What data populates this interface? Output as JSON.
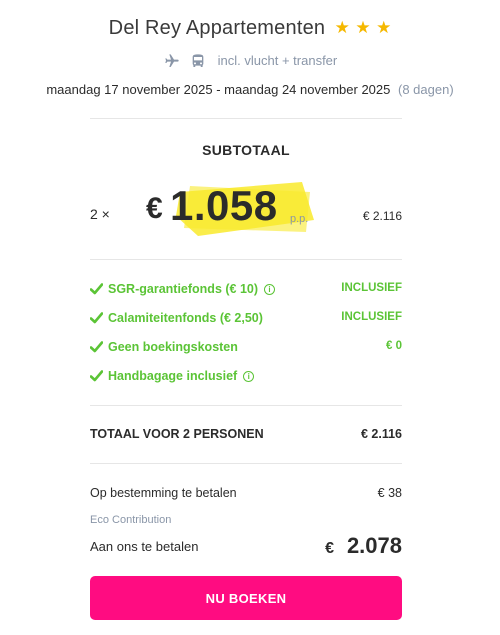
{
  "accommodation": {
    "name": "Del Rey Appartementen",
    "stars": 3,
    "star_glyph": "★",
    "includes_icons": [
      "plane-icon",
      "bus-icon"
    ],
    "includes_text": "incl. vlucht + transfer",
    "dates": "maandag 17 november 2025 - maandag 24 november 2025",
    "duration": "(8 dagen)"
  },
  "pricing": {
    "subtotal_label": "SUBTOTAAL",
    "quantity": "2 ×",
    "currency": "€",
    "price_per_person": "1.058",
    "per_person_label": "p.p.",
    "subtotal_total": "€ 2.116",
    "highlight_color": "#f9ea2c"
  },
  "features": [
    {
      "label": "SGR-garantiefonds (€ 10)",
      "has_info": true,
      "info_glyph": "i",
      "value": "INCLUSIEF"
    },
    {
      "label": "Calamiteitenfonds (€ 2,50)",
      "has_info": false,
      "value": "INCLUSIEF"
    },
    {
      "label": "Geen boekingskosten",
      "has_info": false,
      "value": "€ 0"
    },
    {
      "label": "Handbagage inclusief",
      "has_info": true,
      "info_glyph": "i",
      "value": ""
    }
  ],
  "totals": {
    "total_label": "TOTAAL VOOR 2 PERSONEN",
    "total_value": "€ 2.116",
    "destination_label": "Op bestemming te betalen",
    "destination_value": "€ 38",
    "eco_label": "Eco Contribution",
    "pay_label": "Aan ons te betalen",
    "pay_currency": "€",
    "pay_value": "2.078"
  },
  "book_button": {
    "label": "NU BOEKEN",
    "color": "#ff0c81"
  },
  "colors": {
    "accent_green": "#5bc436",
    "muted": "#8a96a8",
    "star": "#f5b800"
  }
}
